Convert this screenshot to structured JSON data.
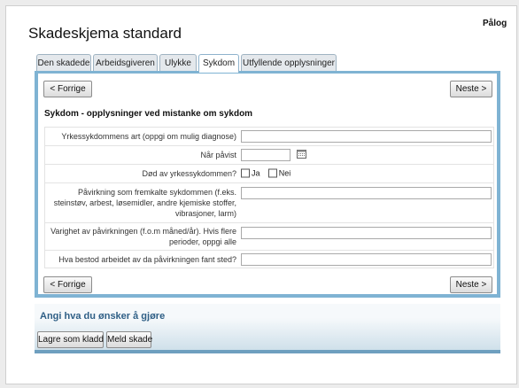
{
  "header": {
    "logout_label": "Pålog",
    "title": "Skadeskjema standard"
  },
  "tabs": [
    {
      "label": "Den skadede",
      "active": false
    },
    {
      "label": "Arbeidsgiveren",
      "active": false
    },
    {
      "label": "Ulykke",
      "active": false
    },
    {
      "label": "Sykdom",
      "active": true
    },
    {
      "label": "Utfyllende opplysninger",
      "active": false
    }
  ],
  "nav": {
    "prev_label": "< Forrige",
    "next_label": "Neste >"
  },
  "section": {
    "heading": "Sykdom - opplysninger ved mistanke om sykdom"
  },
  "form": {
    "rows": [
      {
        "label": "Yrkessykdommens art (oppgi om mulig diagnose)",
        "value": ""
      },
      {
        "label": "Når påvist",
        "value": ""
      },
      {
        "label": "Død av yrkessykdommen?",
        "options": [
          "Ja",
          "Nei"
        ]
      },
      {
        "label": "Påvirkning som fremkalte sykdommen (f.eks. steinstøv, arbest, løsemidler, andre kjemiske stoffer, vibrasjoner, larm)",
        "value": ""
      },
      {
        "label": "Varighet av påvirkningen (f.o.m måned/år). Hvis flere perioder, oppgi alle",
        "value": ""
      },
      {
        "label": "Hva bestod arbeidet av da påvirkningen fant sted?",
        "value": ""
      }
    ]
  },
  "actions": {
    "title": "Angi hva du ønsker å gjøre",
    "save_draft_label": "Lagre som kladd",
    "submit_label": "Meld skade"
  },
  "icons": {
    "calendar": "calendar-icon"
  },
  "colors": {
    "accent": "#7fb3d3",
    "heading_blue": "#2f5f86"
  }
}
